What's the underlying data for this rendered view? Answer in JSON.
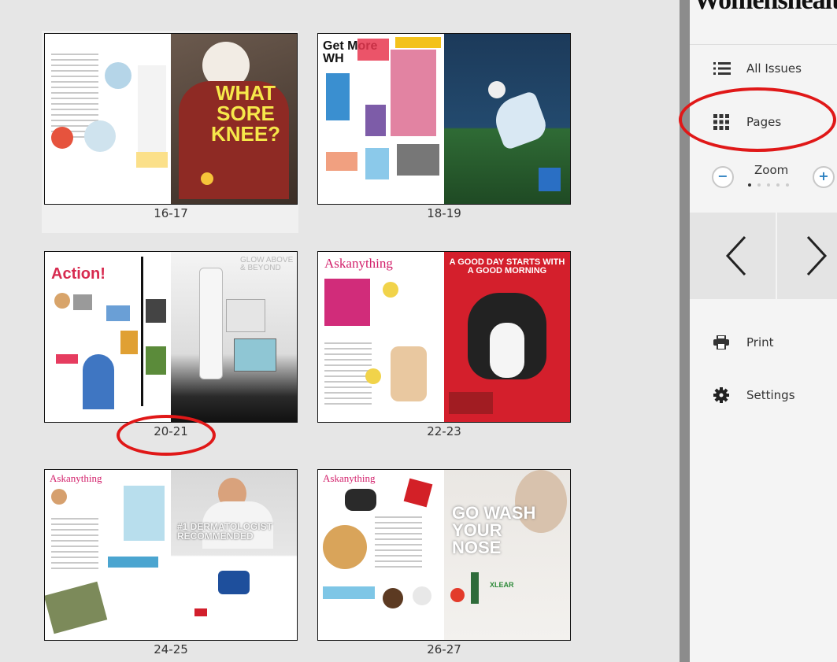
{
  "sidebar": {
    "brand": "Womenshealth",
    "all_issues": "All Issues",
    "pages": "Pages",
    "zoom": "Zoom",
    "zoom_minus": "−",
    "zoom_plus": "+",
    "prev": "<",
    "next": ">",
    "print": "Print",
    "settings": "Settings"
  },
  "spreads": [
    {
      "label": "16-17",
      "headline": "WHAT SORE KNEE?"
    },
    {
      "label": "18-19",
      "headline": "Get More WH"
    },
    {
      "label": "20-21",
      "headline": "Action!",
      "headline_right": "GLOW ABOVE & BEYOND"
    },
    {
      "label": "22-23",
      "headline": "Askanything",
      "headline_right": "A GOOD DAY STARTS WITH A GOOD MORNING"
    },
    {
      "label": "24-25",
      "headline": "Askanything",
      "headline_right": "#1 DERMATOLOGIST RECOMMENDED"
    },
    {
      "label": "26-27",
      "headline": "Askanything",
      "headline_right": "GO WASH YOUR NOSE",
      "product": "XLEAR"
    }
  ],
  "colors": {
    "annotation": "#e01818",
    "accent_blue": "#2a7fc0"
  }
}
